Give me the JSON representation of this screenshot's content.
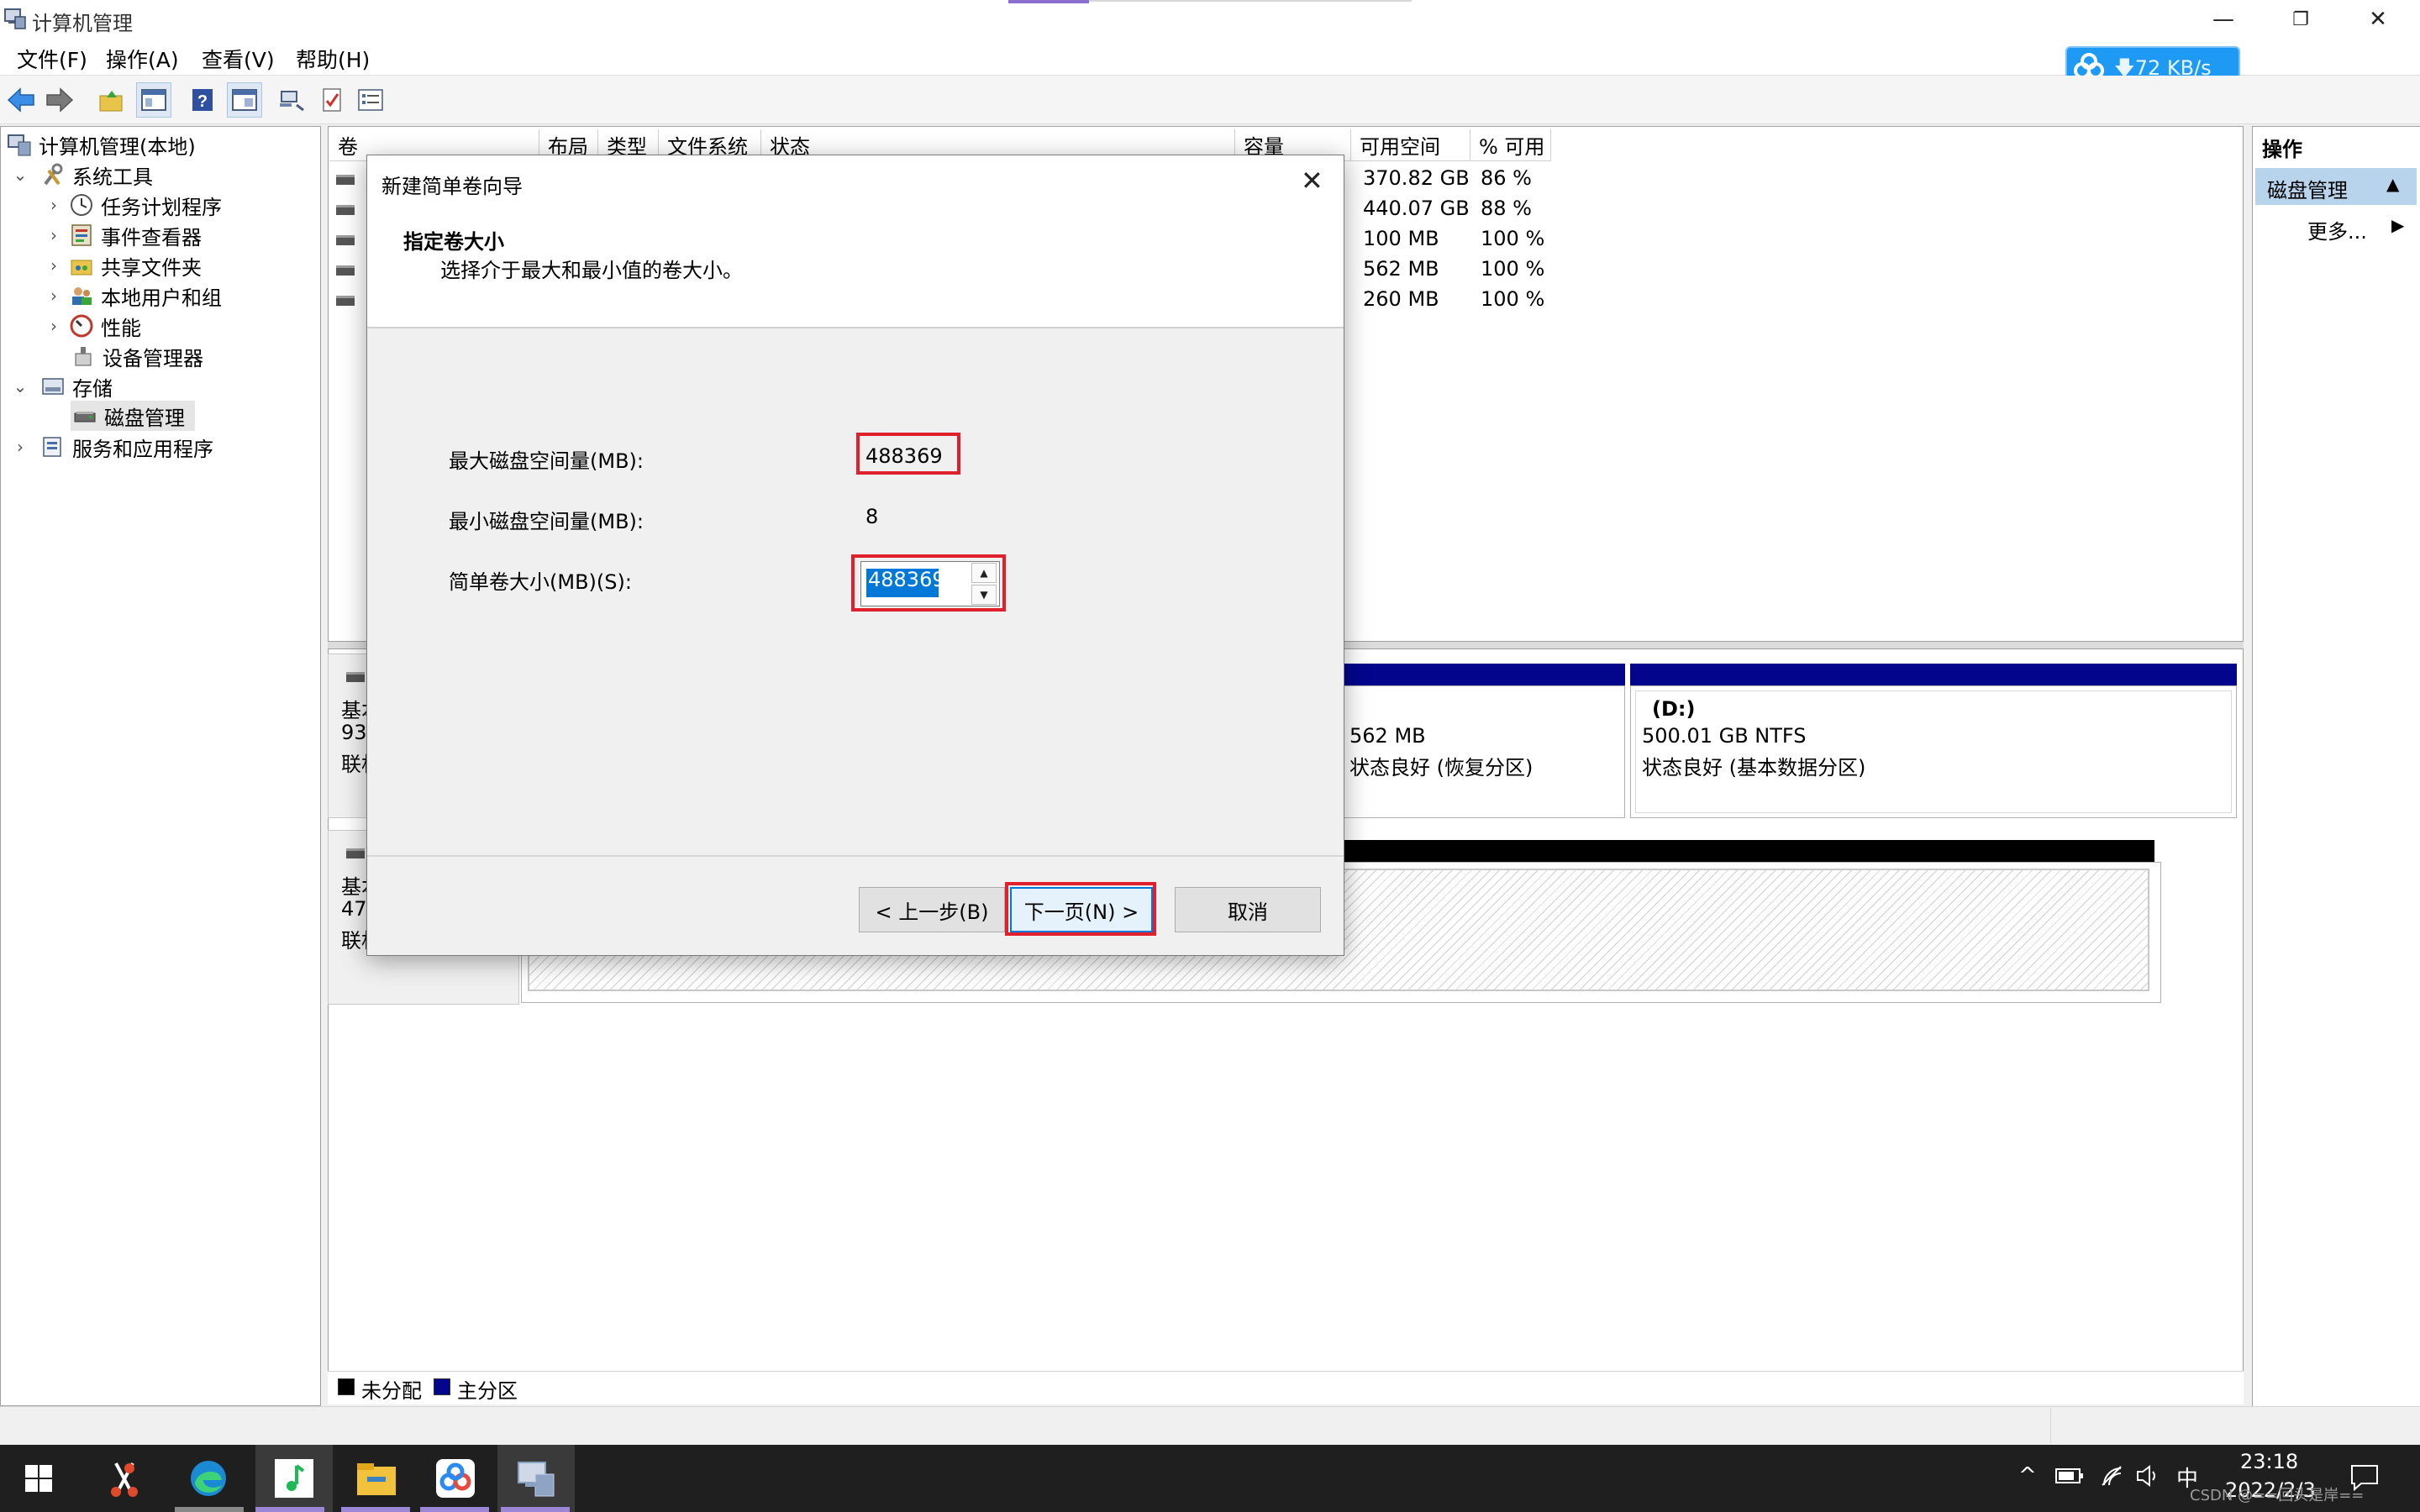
{
  "window": {
    "title": "计算机管理",
    "minimize_glyph": "—",
    "restore_glyph": "❐",
    "close_glyph": "✕"
  },
  "menu": [
    "文件(F)",
    "操作(A)",
    "查看(V)",
    "帮助(H)"
  ],
  "netdisk": {
    "speed": "72 KB/s",
    "arrow": "🡇",
    "icon": "netdisk-cloud-icon"
  },
  "toolbar": {
    "icons": [
      "back-icon",
      "forward-icon",
      "up-folder-icon",
      "show-hide-tree-icon",
      "help-icon",
      "console-icon",
      "connect-icon",
      "properties-icon",
      "list-icon"
    ]
  },
  "tree": {
    "root": "计算机管理(本地)",
    "system_tools": "系统工具",
    "task_scheduler": "任务计划程序",
    "event_viewer": "事件查看器",
    "shared_folders": "共享文件夹",
    "local_users": "本地用户和组",
    "performance": "性能",
    "device_manager": "设备管理器",
    "storage": "存储",
    "disk_management": "磁盘管理",
    "services_apps": "服务和应用程序"
  },
  "volume_list": {
    "columns": [
      "卷",
      "布局",
      "类型",
      "文件系统",
      "状态",
      "容量",
      "可用空间",
      "% 可用"
    ],
    "rows": [
      {
        "free": "370.82 GB",
        "pct": "86 %"
      },
      {
        "free": "440.07 GB",
        "pct": "88 %"
      },
      {
        "free": "100 MB",
        "pct": "100 %"
      },
      {
        "free": "562 MB",
        "pct": "100 %"
      },
      {
        "free": "260 MB",
        "pct": "100 %"
      }
    ]
  },
  "disks": {
    "disk0": {
      "line1": "基本",
      "line2": "93",
      "line3": "联机"
    },
    "disk1": {
      "line1": "基本",
      "line2": "47",
      "line3": "联机"
    },
    "recovery": {
      "size": "562 MB",
      "status": "状态良好 (恢复分区)"
    },
    "d_drive": {
      "name": "(D:)",
      "size": "500.01 GB NTFS",
      "status": "状态良好 (基本数据分区)"
    }
  },
  "legend": {
    "unallocated": "未分配",
    "primary": "主分区",
    "unallocated_color": "#000000",
    "primary_color": "#03068c"
  },
  "actions": {
    "title": "操作",
    "section": "磁盘管理",
    "more": "更多...",
    "collapse_glyph": "▲",
    "more_glyph": "▶"
  },
  "dialog": {
    "title": "新建简单卷向导",
    "heading": "指定卷大小",
    "subheading": "选择介于最大和最小值的卷大小。",
    "max_label": "最大磁盘空间量(MB):",
    "max_value": "488369",
    "min_label": "最小磁盘空间量(MB):",
    "min_value": "8",
    "size_label": "简单卷大小(MB)(S):",
    "size_value": "488369",
    "back_label": "< 上一步(B)",
    "next_label": "下一页(N) >",
    "cancel_label": "取消",
    "highlight_color": "#e0202c"
  },
  "taskbar": {
    "apps": [
      "start-icon",
      "screenshot-tool-icon",
      "edge-icon",
      "music-icon",
      "file-explorer-icon",
      "netdisk-icon",
      "computer-management-icon"
    ],
    "tray": {
      "chevron": "^",
      "ime": "中",
      "time": "23:18",
      "date": "2022/2/3",
      "watermark": "CSDN @==回头是岸=="
    }
  }
}
